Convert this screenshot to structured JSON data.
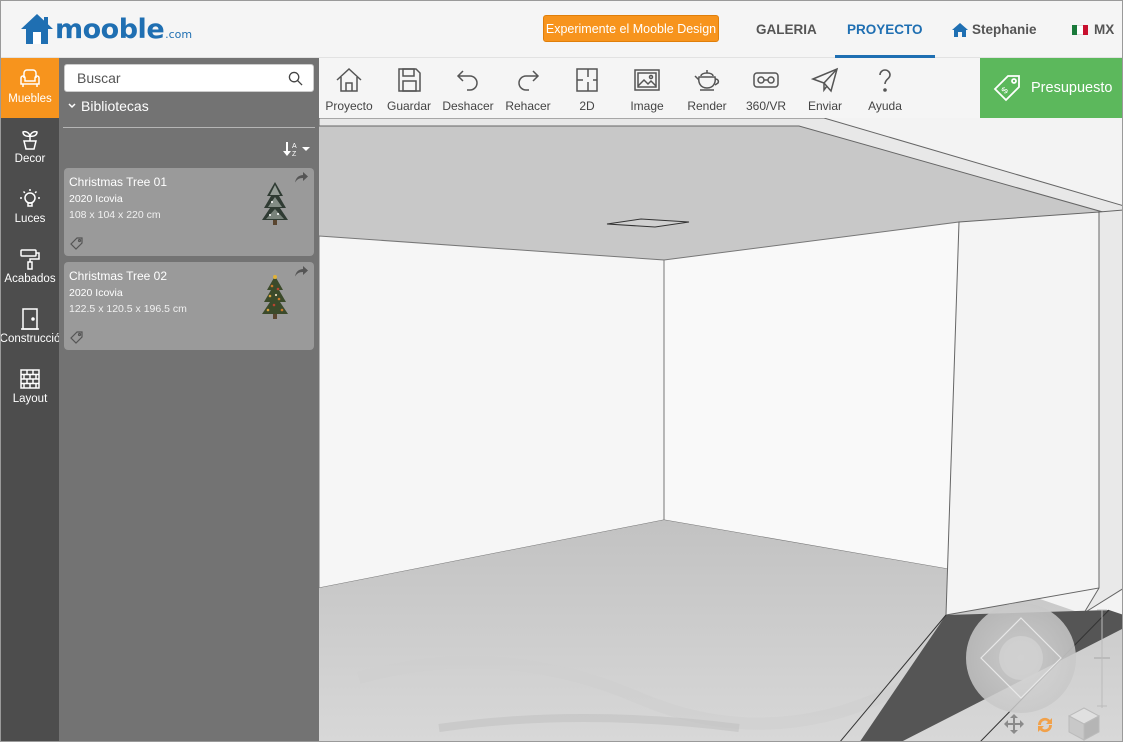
{
  "header": {
    "logo_text": "mooble",
    "logo_domain": ".com",
    "cta_label": "Experimente el Mooble Design",
    "nav": [
      {
        "label": "GALERIA"
      },
      {
        "label": "PROYECTO"
      }
    ],
    "user_name": "Stephanie",
    "country": "MX",
    "colors": {
      "brand": "#1f6fb2",
      "cta": "#f7941d",
      "active_nav": "#1f6fb2"
    }
  },
  "rail": {
    "items": [
      {
        "label": "Muebles",
        "icon": "armchair-icon"
      },
      {
        "label": "Decor",
        "icon": "plant-icon"
      },
      {
        "label": "Luces",
        "icon": "lightbulb-icon"
      },
      {
        "label": "Acabados",
        "icon": "paint-roller-icon"
      },
      {
        "label": "Construcció",
        "icon": "door-icon"
      },
      {
        "label": "Layout",
        "icon": "brick-wall-icon"
      }
    ],
    "active": "Muebles"
  },
  "library": {
    "search_placeholder": "Buscar",
    "section_label": "Bibliotecas",
    "items": [
      {
        "title": "Christmas Tree 01",
        "brand": "2020 Icovia",
        "dims": "108 x 104 x 220 cm"
      },
      {
        "title": "Christmas Tree 02",
        "brand": "2020 Icovia",
        "dims": "122.5 x 120.5 x 196.5 cm"
      }
    ]
  },
  "toolbar": {
    "tools": [
      {
        "label": "Proyecto",
        "icon": "home-icon"
      },
      {
        "label": "Guardar",
        "icon": "save-icon"
      },
      {
        "label": "Deshacer",
        "icon": "undo-icon"
      },
      {
        "label": "Rehacer",
        "icon": "redo-icon"
      },
      {
        "label": "2D",
        "icon": "floorplan-icon"
      },
      {
        "label": "Image",
        "icon": "image-icon"
      },
      {
        "label": "Render",
        "icon": "teapot-icon"
      },
      {
        "label": "360/VR",
        "icon": "vr-headset-icon"
      },
      {
        "label": "Enviar",
        "icon": "paper-plane-icon"
      },
      {
        "label": "Ayuda",
        "icon": "question-icon"
      }
    ],
    "budget_label": "Presupuesto",
    "budget_color": "#5cb85c"
  }
}
